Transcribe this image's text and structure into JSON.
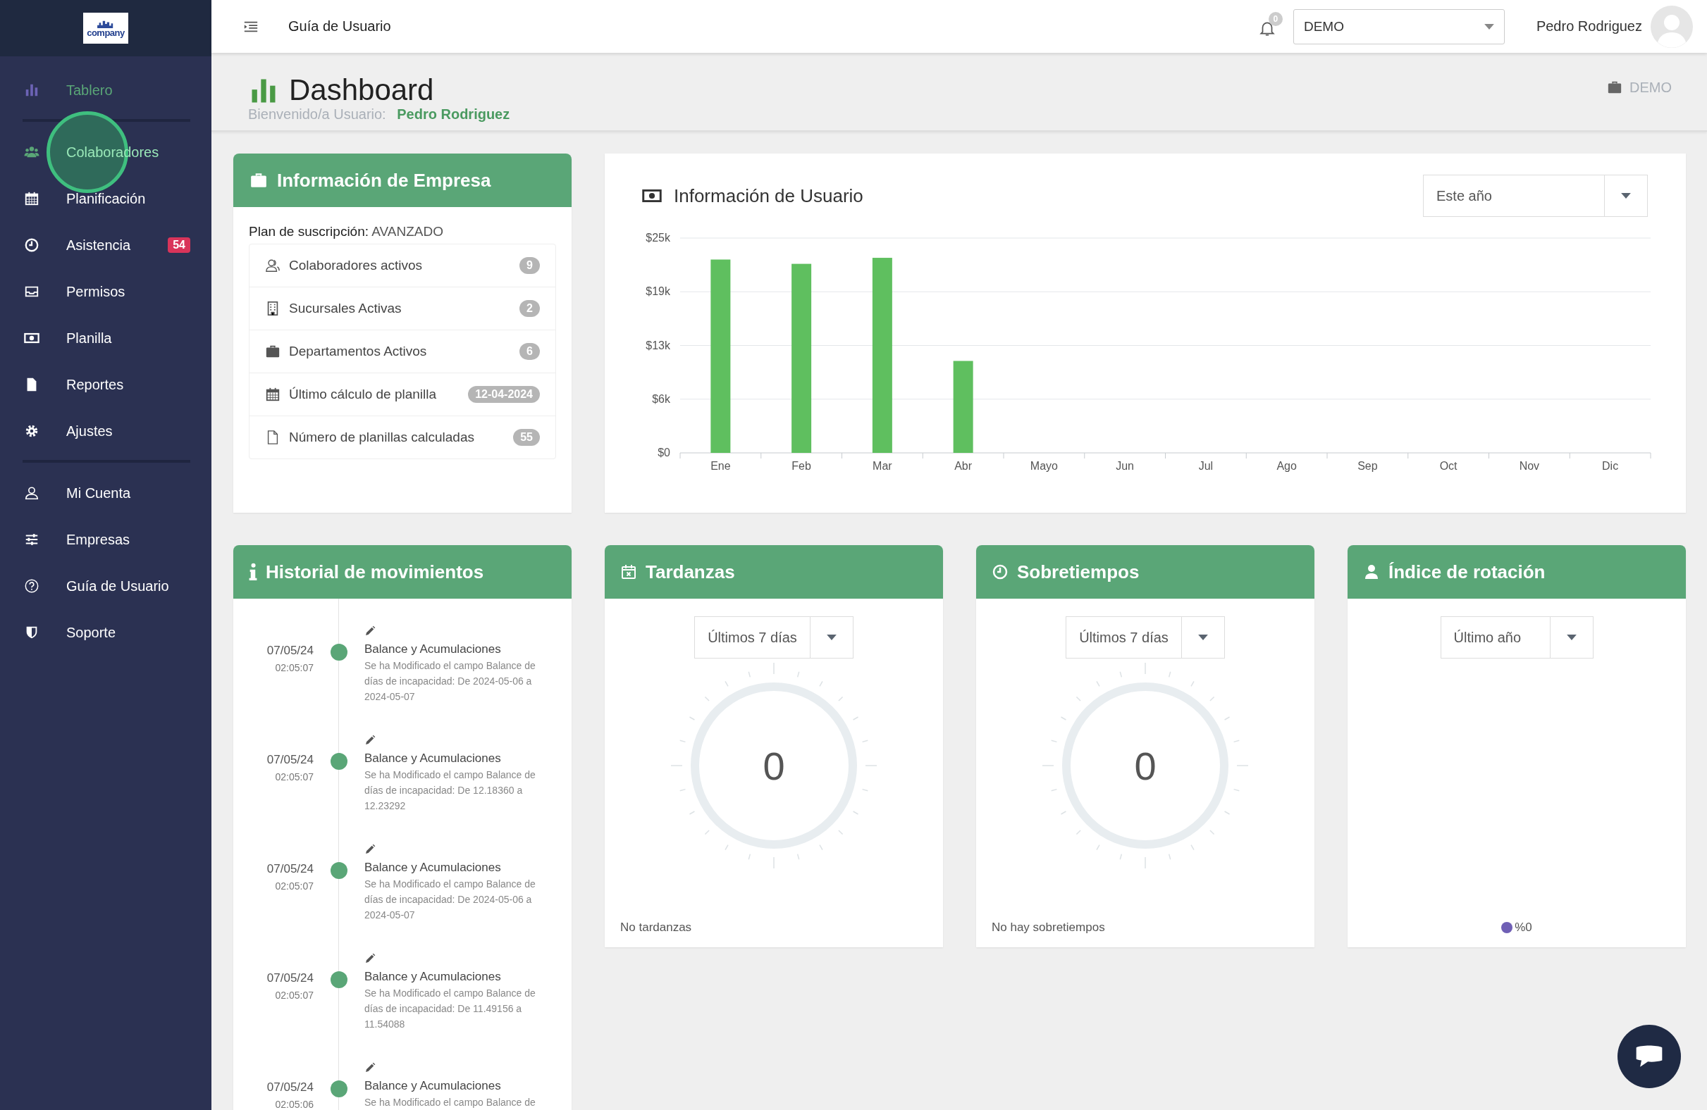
{
  "sidebar": {
    "logo_text": "company",
    "sections": [
      {
        "items": [
          {
            "label": "Tablero",
            "selected": true,
            "hovered": false
          }
        ]
      },
      {
        "items": [
          {
            "label": "Colaboradores",
            "selected": false,
            "hovered": true
          },
          {
            "label": "Planificación",
            "selected": false,
            "hovered": false
          },
          {
            "label": "Asistencia",
            "selected": false,
            "hovered": false,
            "badge": "54"
          },
          {
            "label": "Permisos",
            "selected": false,
            "hovered": false
          },
          {
            "label": "Planilla",
            "selected": false,
            "hovered": false
          },
          {
            "label": "Reportes",
            "selected": false,
            "hovered": false
          },
          {
            "label": "Ajustes",
            "selected": false,
            "hovered": false
          }
        ]
      },
      {
        "items": [
          {
            "label": "Mi Cuenta",
            "selected": false,
            "hovered": false
          },
          {
            "label": "Empresas",
            "selected": false,
            "hovered": false
          },
          {
            "label": "Guía de Usuario",
            "selected": false,
            "hovered": false
          },
          {
            "label": "Soporte",
            "selected": false,
            "hovered": false
          }
        ]
      }
    ]
  },
  "header": {
    "title": "Guía de Usuario",
    "notifications": "0",
    "company_select": "DEMO",
    "user_name": "Pedro Rodriguez"
  },
  "page_header": {
    "title": "Dashboard",
    "welcome_label": "Bienvenido/a Usuario:",
    "welcome_name": "Pedro Rodriguez",
    "company": "DEMO"
  },
  "company_card": {
    "title": "Información de Empresa",
    "plan_label": "Plan de suscripción:",
    "plan_value": "AVANZADO",
    "stats": [
      {
        "label": "Colaboradores activos",
        "value": "9"
      },
      {
        "label": "Sucursales Activas",
        "value": "2"
      },
      {
        "label": "Departamentos Activos",
        "value": "6"
      },
      {
        "label": "Último cálculo de planilla",
        "value": "12-04-2024"
      },
      {
        "label": "Número de planillas calculadas",
        "value": "55"
      }
    ]
  },
  "user_chart": {
    "title": "Información de Usuario",
    "period": "Este año",
    "chart_data": {
      "type": "bar",
      "categories": [
        "Ene",
        "Feb",
        "Mar",
        "Abr",
        "Mayo",
        "Jun",
        "Jul",
        "Ago",
        "Sep",
        "Oct",
        "Nov",
        "Dic"
      ],
      "values": [
        22500,
        22000,
        22700,
        10700,
        0,
        0,
        0,
        0,
        0,
        0,
        0,
        0
      ],
      "grid": true,
      "ylim": [
        0,
        25000
      ],
      "yticks": [
        {
          "value": 0,
          "label": "$0"
        },
        {
          "value": 6250,
          "label": "$6k"
        },
        {
          "value": 12500,
          "label": "$13k"
        },
        {
          "value": 18750,
          "label": "$19k"
        },
        {
          "value": 25000,
          "label": "$25k"
        }
      ]
    }
  },
  "history": {
    "title": "Historial de movimientos",
    "entries": [
      {
        "date": "07/05/24",
        "time": "02:05:07",
        "title": "Balance y Acumulaciones",
        "description": "Se ha Modificado el campo Balance de días de incapacidad: De 2024-05-06 a 2024-05-07"
      },
      {
        "date": "07/05/24",
        "time": "02:05:07",
        "title": "Balance y Acumulaciones",
        "description": "Se ha Modificado el campo Balance de días de incapacidad: De 12.18360 a 12.23292"
      },
      {
        "date": "07/05/24",
        "time": "02:05:07",
        "title": "Balance y Acumulaciones",
        "description": "Se ha Modificado el campo Balance de días de incapacidad: De 2024-05-06 a 2024-05-07"
      },
      {
        "date": "07/05/24",
        "time": "02:05:07",
        "title": "Balance y Acumulaciones",
        "description": "Se ha Modificado el campo Balance de días de incapacidad: De 11.49156 a 11.54088"
      },
      {
        "date": "07/05/24",
        "time": "02:05:06",
        "title": "Balance y Acumulaciones",
        "description": "Se ha Modificado el campo Balance de"
      }
    ]
  },
  "widgets": [
    {
      "kind": "gauge",
      "title": "Tardanzas",
      "period": "Últimos 7 días",
      "value": "0",
      "footer": "No tardanzas"
    },
    {
      "kind": "gauge",
      "title": "Sobretiempos",
      "period": "Últimos 7 días",
      "value": "0",
      "footer": "No hay sobretiempos"
    },
    {
      "kind": "legend",
      "title": "Índice de rotación",
      "period": "Último año",
      "legend": [
        {
          "label": "%0",
          "color": "#6f5fb5"
        }
      ]
    }
  ]
}
